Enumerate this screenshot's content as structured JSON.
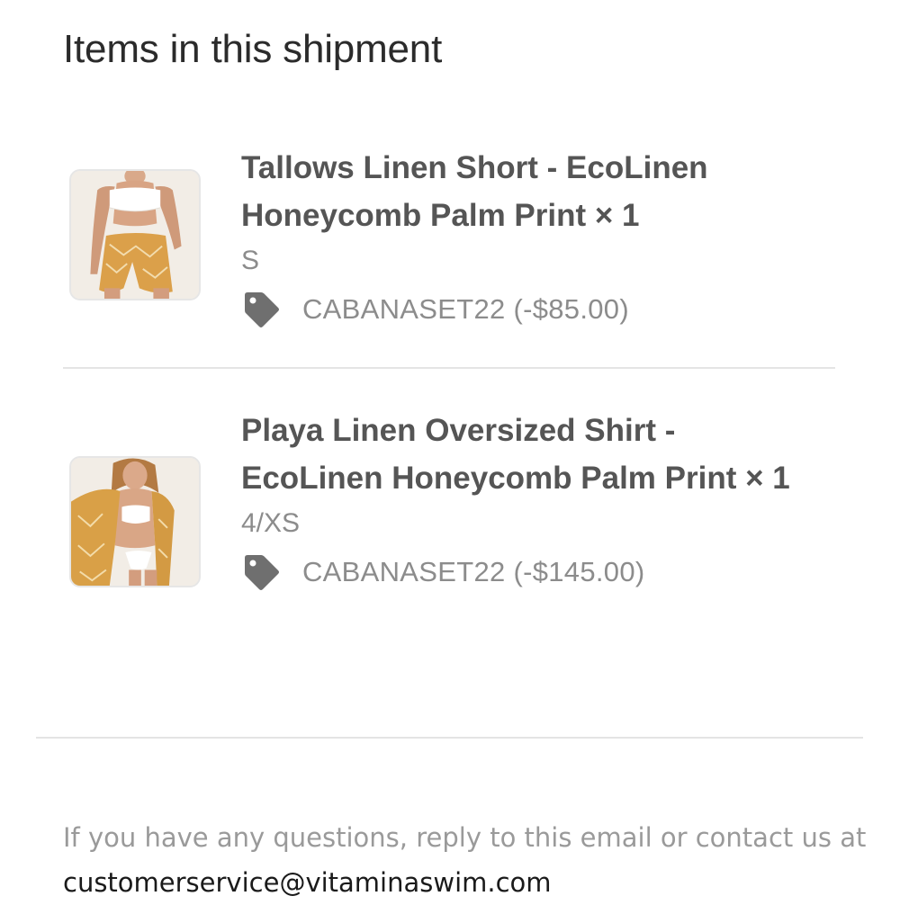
{
  "section": {
    "title": "Items in this shipment"
  },
  "items": [
    {
      "name": "Tallows Linen Short - EcoLinen Honeycomb Palm Print × 1",
      "variant": "S",
      "discount_code": "CABANASET22 (-$85.00)",
      "image_icon": "product-thumbnail"
    },
    {
      "name": "Playa Linen Oversized Shirt - EcoLinen Honeycomb Palm Print × 1",
      "variant": "4/XS",
      "discount_code": "CABANASET22 (-$145.00)",
      "image_icon": "product-thumbnail"
    }
  ],
  "footer": {
    "text": "If you have any questions, reply to this email or contact us at",
    "email": "customerservice@vitaminaswim.com"
  },
  "colors": {
    "title": "#2b2b2b",
    "product_name": "#555555",
    "muted": "#8c8c8c",
    "divider": "#e4e4e4",
    "tag_icon": "#6f6f6f",
    "link": "#1a1a1a"
  },
  "icons": {
    "discount": "tag-icon"
  }
}
